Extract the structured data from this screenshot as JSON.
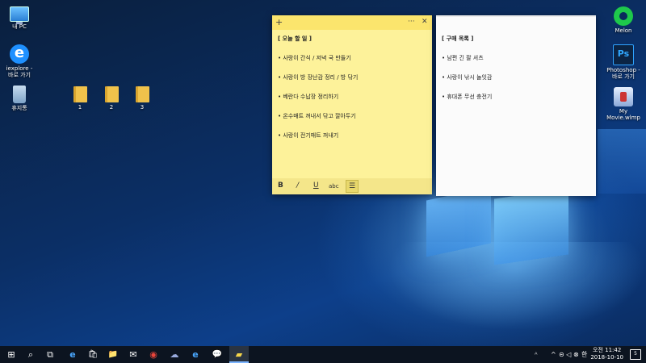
{
  "desktop_icons": {
    "my_pc": "내 PC",
    "iexplore": "iexplore -\n바로 가기",
    "recycle": "휴지통",
    "folder1": "1",
    "folder2": "2",
    "folder3": "3",
    "melon": "Melon",
    "photoshop": "Photoshop -\n바로 가기",
    "mymovie": "My\nMovie.wlmp",
    "ps_glyph": "Ps",
    "ie_glyph": "e"
  },
  "note_today": {
    "title": "[ 오늘 할 일 ]",
    "items": [
      "• 사랑이 간식 / 저녁 국 만들기",
      "• 사랑이 방 장난감 정리 / 방 닦기",
      "• 베란다 수납장 정리하기",
      "• 온수매트 꺼내서 닦고 깔아두기",
      "• 사랑이 전기매트 꺼내기"
    ],
    "add_icon": "+",
    "menu_icon": "···",
    "close_icon": "✕",
    "toolbar": {
      "bold": "B",
      "italic": "/",
      "underline": "U",
      "strike": "abc",
      "list": "☰"
    }
  },
  "note_shopping": {
    "title": "[ 구매 목록 ]",
    "items": [
      "• 남편 긴 팔 셔츠",
      "• 사랑이 낚시 놀잇감",
      "• 휴대폰 무선 충전기"
    ]
  },
  "taskbar": {
    "start_icon": "⊞",
    "search_icon": "⌕",
    "taskview_icon": "⧉",
    "edge_icon": "e",
    "store_icon": "🛍",
    "explorer_icon": "📁",
    "mail_icon": "✉",
    "chrome_icon": "◉",
    "weather_icon": "☁",
    "ie_icon": "e",
    "kakao_icon": "💬",
    "sticky_icon": "▰",
    "tray_user": "ᴬ",
    "tray_arrow": "^",
    "tray_icons": "⊝ ◁ ⊗",
    "tray_ime": "한",
    "clock_time": "오전 11:42",
    "clock_date": "2018-10-10",
    "notif_count": "5"
  }
}
